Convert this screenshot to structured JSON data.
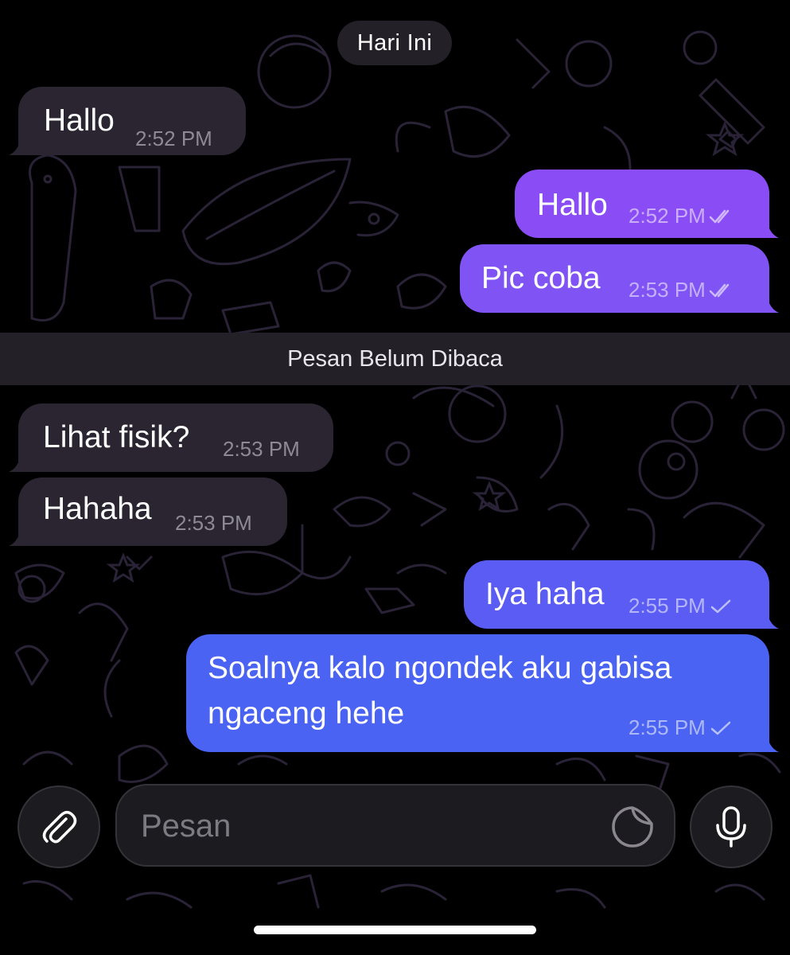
{
  "chat": {
    "date_label": "Hari Ini",
    "unread_label": "Pesan Belum Dibaca",
    "messages": [
      {
        "direction": "incoming",
        "text": "Hallo",
        "time": "2:52 PM"
      },
      {
        "direction": "outgoing",
        "text": "Hallo",
        "time": "2:52 PM",
        "status": "read"
      },
      {
        "direction": "outgoing",
        "text": "Pic coba",
        "time": "2:53 PM",
        "status": "read"
      },
      {
        "direction": "incoming",
        "text": "Lihat fisik?",
        "time": "2:53 PM"
      },
      {
        "direction": "incoming",
        "text": "Hahaha",
        "time": "2:53 PM"
      },
      {
        "direction": "outgoing",
        "text": "Iya haha",
        "time": "2:55 PM",
        "status": "sent"
      },
      {
        "direction": "outgoing",
        "text_line1": "Soalnya kalo ngondek aku gabisa",
        "text_line2": "ngaceng hehe",
        "time": "2:55 PM",
        "status": "sent"
      }
    ]
  },
  "composer": {
    "placeholder": "Pesan",
    "attach_icon": "paperclip-icon",
    "sticker_icon": "sticker-icon",
    "mic_icon": "microphone-icon"
  },
  "colors": {
    "incoming_bubble": "#2a2530",
    "outgoing_gradient_top": "#8a4df5",
    "outgoing_gradient_bottom": "#4a63f2",
    "background": "#000000"
  }
}
